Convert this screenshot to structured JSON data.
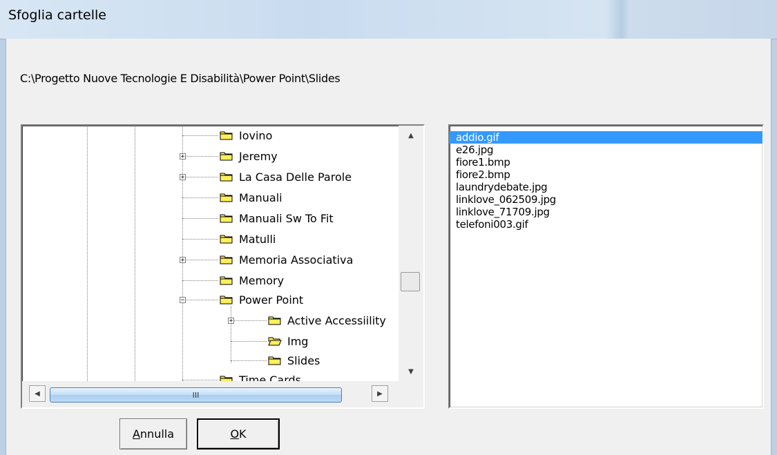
{
  "window": {
    "title": "Sfoglia cartelle"
  },
  "path": "C:\\Progetto Nuove Tecnologie E Disabilità\\Power Point\\Slides",
  "tree": {
    "nodes": [
      {
        "label": "Iovino",
        "expander": "",
        "open": false
      },
      {
        "label": "Jeremy",
        "expander": "+",
        "open": false
      },
      {
        "label": "La Casa Delle Parole",
        "expander": "+",
        "open": false
      },
      {
        "label": "Manuali",
        "expander": "",
        "open": false
      },
      {
        "label": "Manuali Sw To Fit",
        "expander": "",
        "open": false
      },
      {
        "label": "Matulli",
        "expander": "",
        "open": false
      },
      {
        "label": "Memoria Associativa",
        "expander": "+",
        "open": false
      },
      {
        "label": "Memory",
        "expander": "",
        "open": false
      },
      {
        "label": "Power Point",
        "expander": "−",
        "open": false
      },
      {
        "label": "Active Accessiility",
        "expander": "+",
        "open": false
      },
      {
        "label": "Img",
        "expander": "",
        "open": true
      },
      {
        "label": "Slides",
        "expander": "",
        "open": false
      },
      {
        "label": "Time Cards",
        "expander": "",
        "open": false
      }
    ],
    "scroll_up": "▲",
    "scroll_down": "▼",
    "scroll_left": "◀",
    "scroll_right": "▶",
    "hthumb_grip": "III"
  },
  "files": [
    {
      "name": "addio.gif",
      "selected": true
    },
    {
      "name": "e26.jpg",
      "selected": false
    },
    {
      "name": "fiore1.bmp",
      "selected": false
    },
    {
      "name": "fiore2.bmp",
      "selected": false
    },
    {
      "name": "laundrydebate.jpg",
      "selected": false
    },
    {
      "name": "linklove_062509.jpg",
      "selected": false
    },
    {
      "name": "linklove_71709.jpg",
      "selected": false
    },
    {
      "name": "telefoni003.gif",
      "selected": false
    }
  ],
  "buttons": {
    "cancel_mnemonic": "A",
    "cancel_rest": "nnulla",
    "ok_mnemonic": "O",
    "ok_rest": "K"
  },
  "colors": {
    "selection": "#3399ff",
    "folder_fill": "#ffef5a",
    "folder_stroke": "#000000"
  }
}
